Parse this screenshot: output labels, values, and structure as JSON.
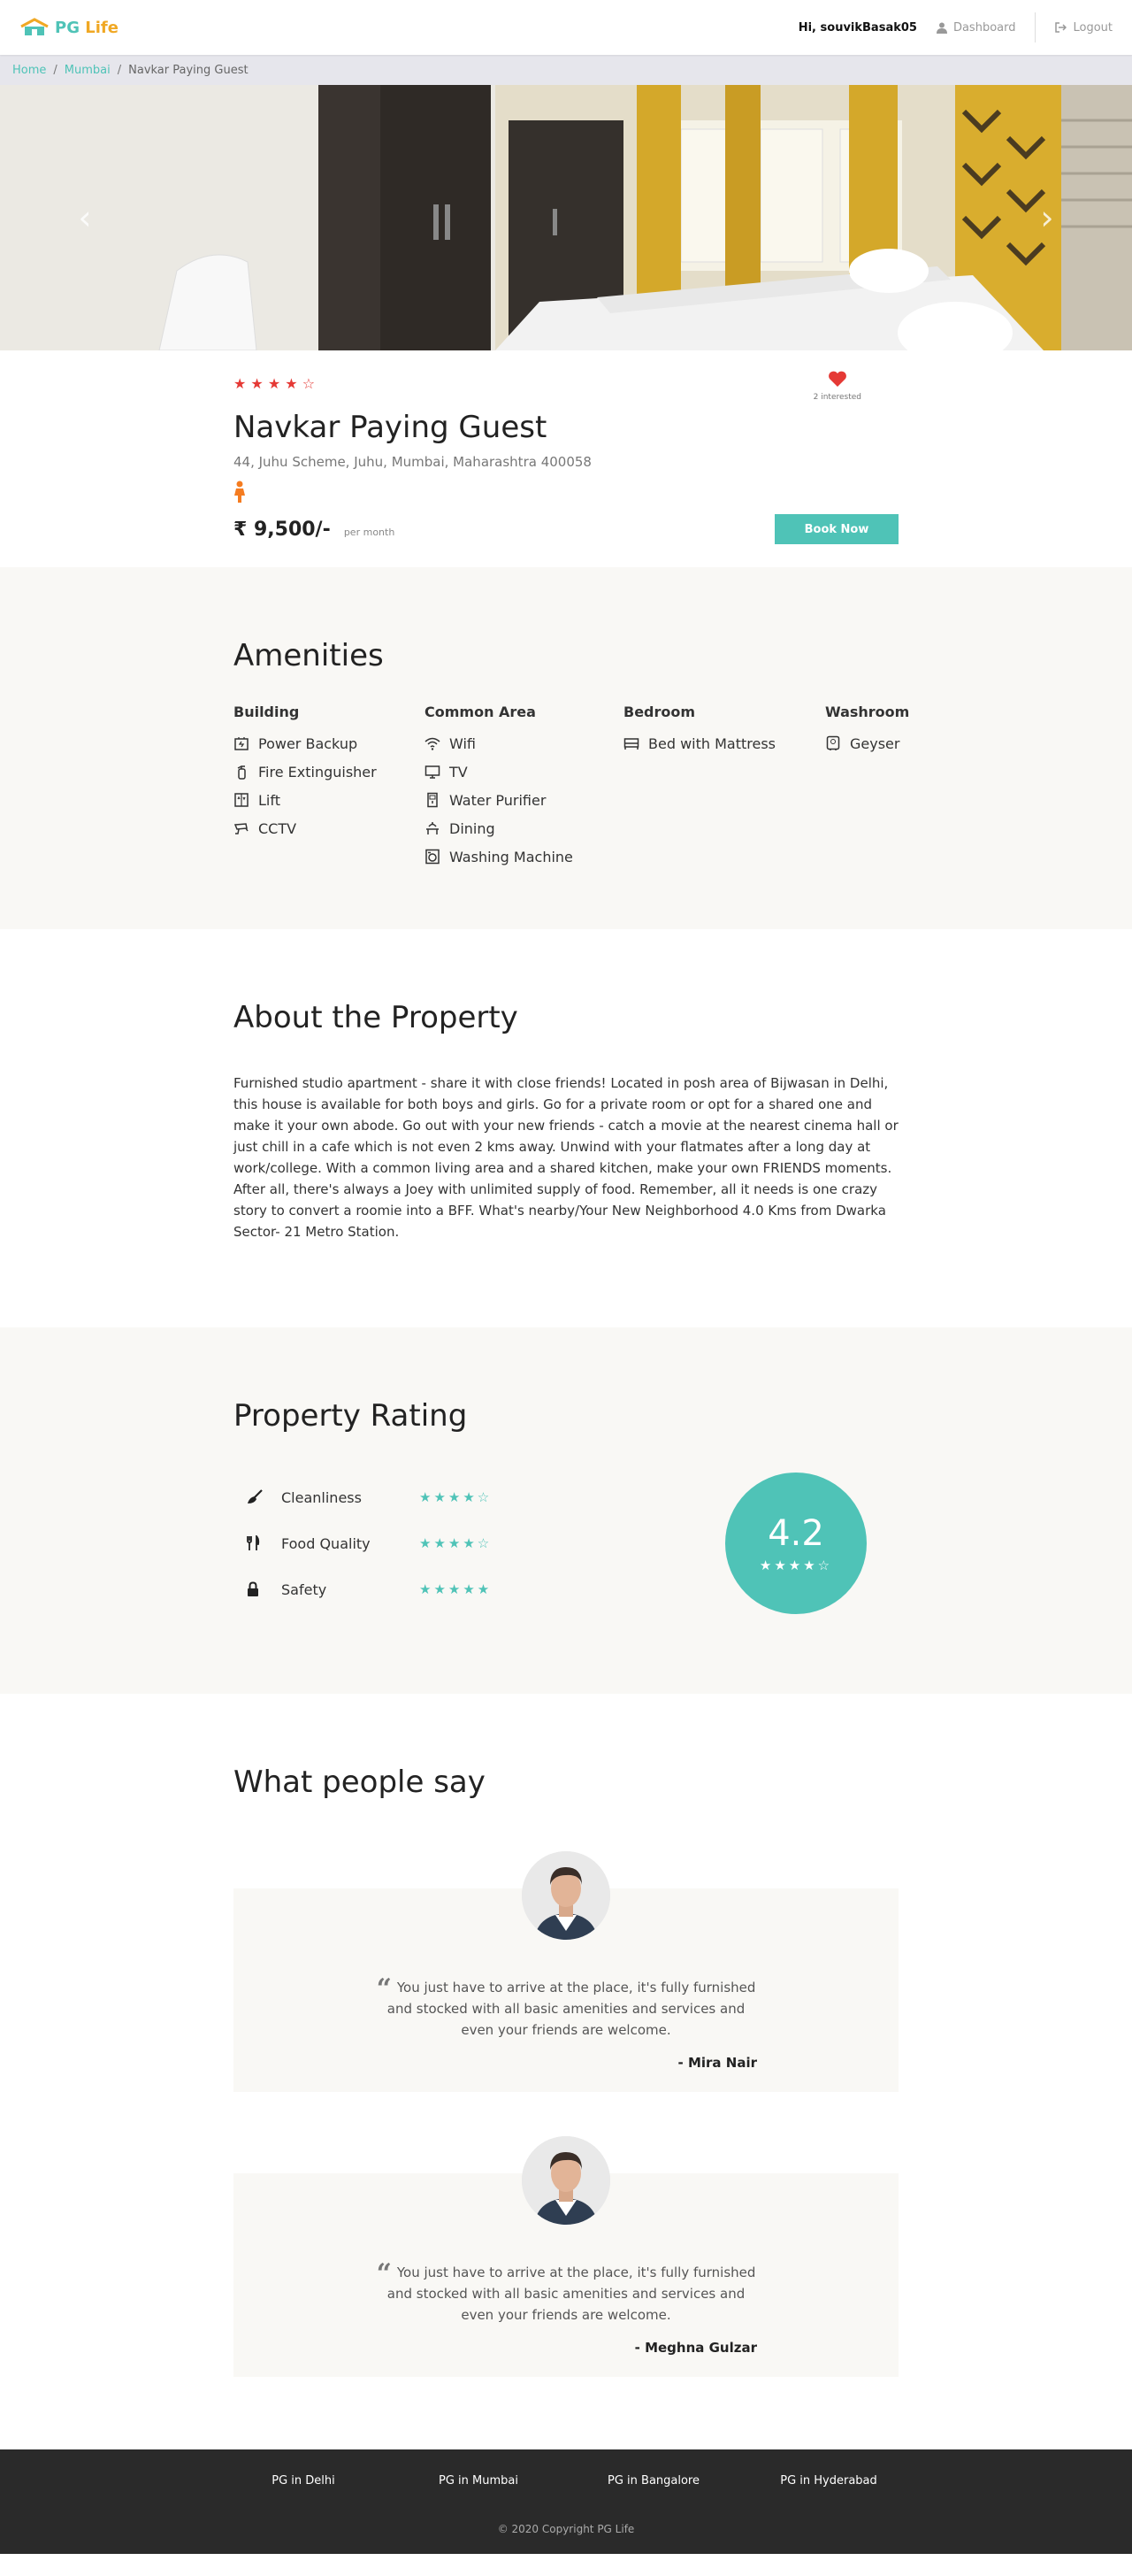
{
  "header": {
    "logo_text_a": "PG",
    "logo_text_b": " Life",
    "greeting": "Hi, souvikBasak05",
    "dashboard_label": "Dashboard",
    "logout_label": "Logout"
  },
  "breadcrumb": {
    "items": [
      "Home",
      "Mumbai",
      "Navkar Paying Guest"
    ],
    "separator": "/"
  },
  "carousel": {
    "prev_label": "‹",
    "next_label": "›"
  },
  "property": {
    "stars": "★ ★ ★ ★ ☆",
    "rating_stars_count": 4,
    "interested": "2 interested",
    "name": "Navkar Paying Guest",
    "address": "44, Juhu Scheme, Juhu, Mumbai, Maharashtra 400058",
    "gender_icon": "female-icon",
    "price": "₹ 9,500/-",
    "price_unit": "per month",
    "book_label": "Book Now"
  },
  "amenities": {
    "title": "Amenities",
    "groups": [
      {
        "heading": "Building",
        "items": [
          {
            "label": "Power Backup",
            "icon": "power-backup-icon"
          },
          {
            "label": "Fire Extinguisher",
            "icon": "fire-extinguisher-icon"
          },
          {
            "label": "Lift",
            "icon": "lift-icon"
          },
          {
            "label": "CCTV",
            "icon": "cctv-icon"
          }
        ]
      },
      {
        "heading": "Common Area",
        "items": [
          {
            "label": "Wifi",
            "icon": "wifi-icon"
          },
          {
            "label": "TV",
            "icon": "tv-icon"
          },
          {
            "label": "Water Purifier",
            "icon": "water-purifier-icon"
          },
          {
            "label": "Dining",
            "icon": "dining-icon"
          },
          {
            "label": "Washing Machine",
            "icon": "washing-machine-icon"
          }
        ]
      },
      {
        "heading": "Bedroom",
        "items": [
          {
            "label": "Bed with Mattress",
            "icon": "bed-icon"
          }
        ]
      },
      {
        "heading": "Washroom",
        "items": [
          {
            "label": "Geyser",
            "icon": "geyser-icon"
          }
        ]
      }
    ]
  },
  "about": {
    "title": "About the Property",
    "text": "Furnished studio apartment - share it with close friends! Located in posh area of Bijwasan in Delhi, this house is available for both boys and girls. Go for a private room or opt for a shared one and make it your own abode. Go out with your new friends - catch a movie at the nearest cinema hall or just chill in a cafe which is not even 2 kms away. Unwind with your flatmates after a long day at work/college. With a common living area and a shared kitchen, make your own FRIENDS moments. After all, there's always a Joey with unlimited supply of food. Remember, all it needs is one crazy story to convert a roomie into a BFF. What's nearby/Your New Neighborhood 4.0 Kms from Dwarka Sector- 21 Metro Station."
  },
  "rating": {
    "title": "Property Rating",
    "items": [
      {
        "label": "Cleanliness",
        "icon": "broom-icon",
        "stars": "★★★★☆",
        "value": 4
      },
      {
        "label": "Food Quality",
        "icon": "utensils-icon",
        "stars": "★★★★☆",
        "value": 4
      },
      {
        "label": "Safety",
        "icon": "lock-icon",
        "stars": "★★★★★",
        "value": 5
      }
    ],
    "overall": "4.2",
    "overall_stars": "★★★★☆"
  },
  "testimonials": {
    "title": "What people say",
    "items": [
      {
        "quote": "You just have to arrive at the place, it's fully furnished and stocked with all basic amenities and services and even your friends are welcome.",
        "author": "- Mira Nair"
      },
      {
        "quote": "You just have to arrive at the place, it's fully furnished and stocked with all basic amenities and services and even your friends are welcome.",
        "author": "- Meghna Gulzar"
      }
    ]
  },
  "footer": {
    "links": [
      "PG in Delhi",
      "PG in Mumbai",
      "PG in Bangalore",
      "PG in Hyderabad"
    ],
    "copyright": "© 2020 Copyright PG Life"
  },
  "colors": {
    "accent": "#4fc3b7",
    "star_red": "#e53935",
    "footer_bg": "#2a2a2a",
    "beige_bg": "#f9f8f5"
  }
}
